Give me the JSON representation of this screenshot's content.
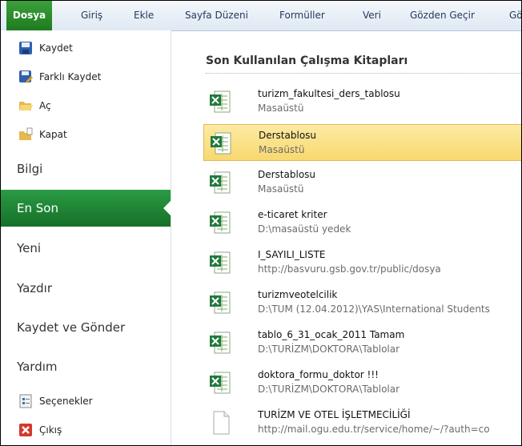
{
  "ribbon": {
    "tabs": [
      "Dosya",
      "Giriş",
      "Ekle",
      "Sayfa Düzeni",
      "Formüller",
      "Veri",
      "Gözden Geçir",
      "Gö"
    ]
  },
  "nav": {
    "commands_top": [
      {
        "label": "Kaydet",
        "icon": "save-icon"
      },
      {
        "label": "Farklı Kaydet",
        "icon": "save-as-icon"
      },
      {
        "label": "Aç",
        "icon": "open-folder-icon"
      },
      {
        "label": "Kapat",
        "icon": "close-folder-icon"
      }
    ],
    "tabs": [
      "Bilgi",
      "En Son",
      "Yeni",
      "Yazdır",
      "Kaydet ve Gönder",
      "Yardım"
    ],
    "active_tab": "En Son",
    "commands_bottom": [
      {
        "label": "Seçenekler",
        "icon": "options-icon"
      },
      {
        "label": "Çıkış",
        "icon": "exit-icon"
      }
    ]
  },
  "recent": {
    "title": "Son Kullanılan Çalışma Kitapları",
    "items": [
      {
        "name": "turizm_fakultesi_ders_tablosu",
        "path": "Masaüstü",
        "icon": "excel-file-icon"
      },
      {
        "name": "Derstablosu",
        "path": "Masaüstü",
        "icon": "excel-file-icon",
        "selected": true
      },
      {
        "name": "Derstablosu",
        "path": "Masaüstü",
        "icon": "excel-file-icon"
      },
      {
        "name": "e-ticaret kriter",
        "path": "D:\\masaüstü yedek",
        "icon": "excel-file-icon"
      },
      {
        "name": "I_SAYILI_LISTE",
        "path": "http://basvuru.gsb.gov.tr/public/dosya",
        "icon": "excel-file-icon"
      },
      {
        "name": "turizmveotelcilik",
        "path": "D:\\TUM (12.04.2012)\\YAS\\International Students",
        "icon": "excel-file-icon"
      },
      {
        "name": "tablo_6_31_ocak_2011 Tamam",
        "path": "D:\\TURİZM\\DOKTORA\\Tablolar",
        "icon": "excel-file-icon"
      },
      {
        "name": "doktora_formu_doktor !!!",
        "path": "D:\\TURİZM\\DOKTORA\\Tablolar",
        "icon": "excel-file-icon"
      },
      {
        "name": "TURİZM VE OTEL İŞLETMECİLİĞİ",
        "path": "http://mail.ogu.edu.tr/service/home/~/?auth=co",
        "icon": "blank-file-icon"
      }
    ]
  },
  "colors": {
    "accent_green": "#1e7b32",
    "selection": "#f8d86f",
    "ribbon_text": "#1e395b"
  }
}
